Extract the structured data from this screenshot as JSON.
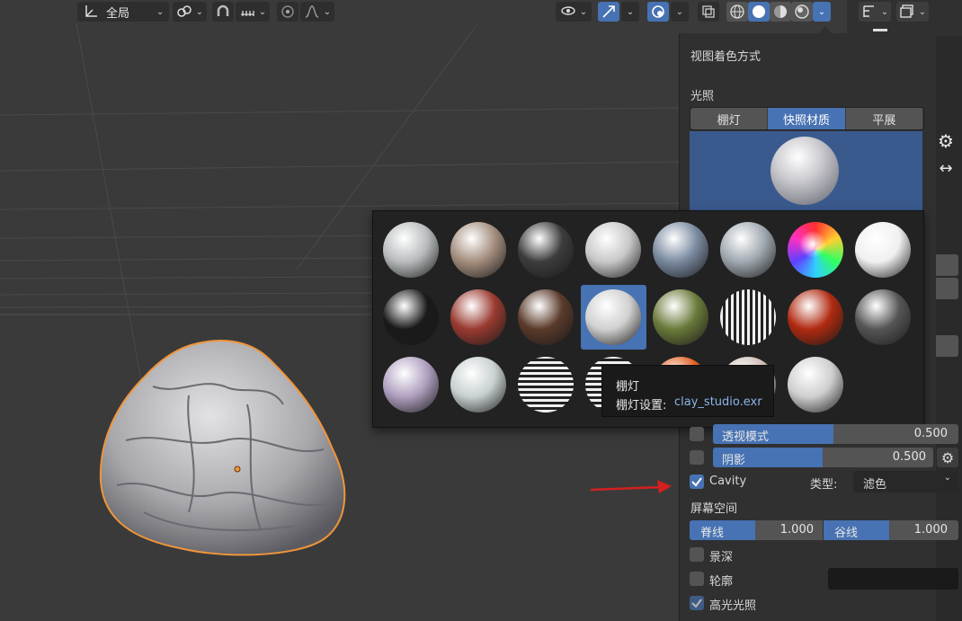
{
  "header": {
    "transform_orientation": "全局"
  },
  "panel": {
    "title": "视图着色方式",
    "lighting_label": "光照",
    "lighting_modes": [
      "棚灯",
      "快照材质",
      "平展"
    ],
    "active_lighting_mode": "快照材质"
  },
  "tooltip": {
    "title": "棚灯",
    "setting_label": "棚灯设置:",
    "setting_value": "clay_studio.exr"
  },
  "options": {
    "xray_label": "透视模式",
    "xray_value": "0.500",
    "shadow_label": "阴影",
    "shadow_value": "0.500",
    "cavity_label": "Cavity",
    "cavity_checked": true,
    "type_label": "类型:",
    "type_value": "滤色",
    "screen_space_label": "屏幕空间",
    "ridge_label": "脊线",
    "ridge_value": "1.000",
    "valley_label": "谷线",
    "valley_value": "1.000",
    "dof_label": "景深",
    "outline_label": "轮廓",
    "specular_label": "高光光照",
    "specular_checked": true
  },
  "matcaps": [
    {
      "name": "matcap-1",
      "color": "#b8bcbd"
    },
    {
      "name": "matcap-2",
      "color": "#a48e7e"
    },
    {
      "name": "matcap-3",
      "color": "#3c3c3c"
    },
    {
      "name": "matcap-4",
      "color": "#c8c8c8"
    },
    {
      "name": "matcap-5",
      "color": "#7a8aa0"
    },
    {
      "name": "matcap-6",
      "color": "#a0a8b0"
    },
    {
      "name": "matcap-7",
      "color": "rainbow"
    },
    {
      "name": "matcap-8",
      "color": "#f0f0f0"
    },
    {
      "name": "matcap-9",
      "color": "#1a1a1a"
    },
    {
      "name": "matcap-10",
      "color": "#9a3a30"
    },
    {
      "name": "matcap-11",
      "color": "#5a3a2a"
    },
    {
      "name": "matcap-12",
      "color": "#d0d0d0"
    },
    {
      "name": "matcap-13",
      "color": "#6a7a3a"
    },
    {
      "name": "matcap-14",
      "color": "#c0c0c0"
    },
    {
      "name": "matcap-15",
      "color": "#b02a10"
    },
    {
      "name": "matcap-16",
      "color": "#555555"
    },
    {
      "name": "matcap-17",
      "color": "#b0a0c0"
    },
    {
      "name": "matcap-18",
      "color": "#c8d0d0"
    },
    {
      "name": "matcap-19",
      "color": "#d0d0d0"
    },
    {
      "name": "matcap-20",
      "color": "#d0d0d0"
    },
    {
      "name": "matcap-21",
      "color": "#e06020"
    },
    {
      "name": "matcap-22",
      "color": "#d0c0b8"
    },
    {
      "name": "matcap-23",
      "color": "#cfcfcf"
    }
  ],
  "colors": {
    "accent": "#4772b3",
    "viewport": "#3a3a3a",
    "selection_outline": "#f0953a",
    "arrow": "#d42020"
  }
}
